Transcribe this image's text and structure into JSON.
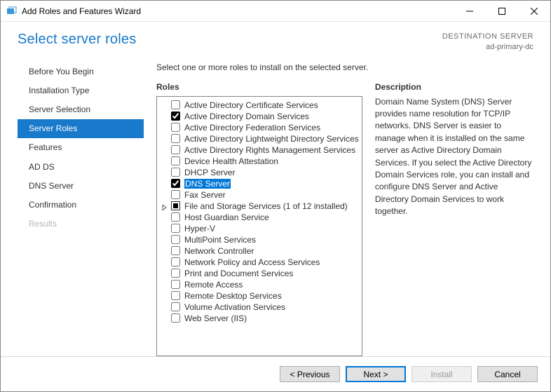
{
  "window": {
    "title": "Add Roles and Features Wizard"
  },
  "header": {
    "page_title": "Select server roles",
    "dest_label": "DESTINATION SERVER",
    "dest_value": "ad-primary-dc"
  },
  "nav": [
    {
      "label": "Before You Begin",
      "active": false,
      "disabled": false
    },
    {
      "label": "Installation Type",
      "active": false,
      "disabled": false
    },
    {
      "label": "Server Selection",
      "active": false,
      "disabled": false
    },
    {
      "label": "Server Roles",
      "active": true,
      "disabled": false
    },
    {
      "label": "Features",
      "active": false,
      "disabled": false
    },
    {
      "label": "AD DS",
      "active": false,
      "disabled": false
    },
    {
      "label": "DNS Server",
      "active": false,
      "disabled": false
    },
    {
      "label": "Confirmation",
      "active": false,
      "disabled": false
    },
    {
      "label": "Results",
      "active": false,
      "disabled": true
    }
  ],
  "instruction": "Select one or more roles to install on the selected server.",
  "roles_label": "Roles",
  "desc_label": "Description",
  "roles": [
    {
      "label": "Active Directory Certificate Services",
      "state": "unchecked"
    },
    {
      "label": "Active Directory Domain Services",
      "state": "checked"
    },
    {
      "label": "Active Directory Federation Services",
      "state": "unchecked"
    },
    {
      "label": "Active Directory Lightweight Directory Services",
      "state": "unchecked"
    },
    {
      "label": "Active Directory Rights Management Services",
      "state": "unchecked"
    },
    {
      "label": "Device Health Attestation",
      "state": "unchecked"
    },
    {
      "label": "DHCP Server",
      "state": "unchecked"
    },
    {
      "label": "DNS Server",
      "state": "checked",
      "selected": true
    },
    {
      "label": "Fax Server",
      "state": "unchecked"
    },
    {
      "label": "File and Storage Services (1 of 12 installed)",
      "state": "partial",
      "expander": true
    },
    {
      "label": "Host Guardian Service",
      "state": "unchecked"
    },
    {
      "label": "Hyper-V",
      "state": "unchecked"
    },
    {
      "label": "MultiPoint Services",
      "state": "unchecked"
    },
    {
      "label": "Network Controller",
      "state": "unchecked"
    },
    {
      "label": "Network Policy and Access Services",
      "state": "unchecked"
    },
    {
      "label": "Print and Document Services",
      "state": "unchecked"
    },
    {
      "label": "Remote Access",
      "state": "unchecked"
    },
    {
      "label": "Remote Desktop Services",
      "state": "unchecked"
    },
    {
      "label": "Volume Activation Services",
      "state": "unchecked"
    },
    {
      "label": "Web Server (IIS)",
      "state": "unchecked"
    }
  ],
  "description": "Domain Name System (DNS) Server provides name resolution for TCP/IP networks. DNS Server is easier to manage when it is installed on the same server as Active Directory Domain Services. If you select the Active Directory Domain Services role, you can install and configure DNS Server and Active Directory Domain Services to work together.",
  "buttons": {
    "previous": "< Previous",
    "next": "Next >",
    "install": "Install",
    "cancel": "Cancel"
  }
}
